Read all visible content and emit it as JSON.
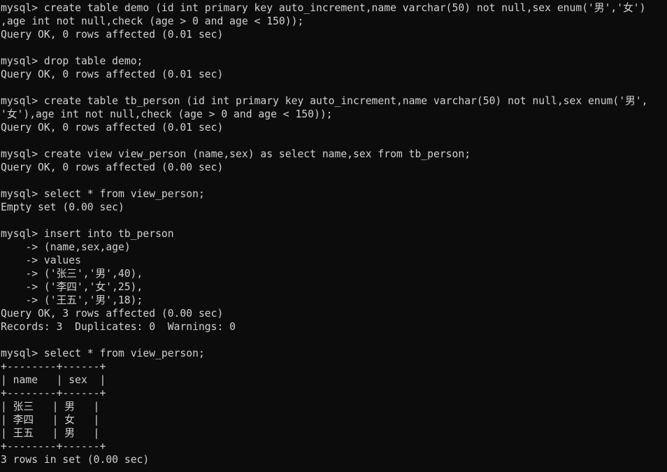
{
  "terminal": {
    "prompt": "mysql> ",
    "continuation_prompt": "    -> ",
    "background_color": "#0c0c0c",
    "text_color": "#d2d2d2",
    "columns": 106,
    "rows": 35,
    "lines": [
      "mysql> create table demo (id int primary key auto_increment,name varchar(50) not null,sex enum('男','女')",
      ",age int not null,check (age > 0 and age < 150));",
      "Query OK, 0 rows affected (0.01 sec)",
      "",
      "mysql> drop table demo;",
      "Query OK, 0 rows affected (0.01 sec)",
      "",
      "mysql> create table tb_person (id int primary key auto_increment,name varchar(50) not null,sex enum('男',",
      "'女'),age int not null,check (age > 0 and age < 150));",
      "Query OK, 0 rows affected (0.01 sec)",
      "",
      "mysql> create view view_person (name,sex) as select name,sex from tb_person;",
      "Query OK, 0 rows affected (0.00 sec)",
      "",
      "mysql> select * from view_person;",
      "Empty set (0.00 sec)",
      "",
      "mysql> insert into tb_person",
      "    -> (name,sex,age)",
      "    -> values",
      "    -> ('张三','男',40),",
      "    -> ('李四','女',25),",
      "    -> ('王五','男',18);",
      "Query OK, 3 rows affected (0.00 sec)",
      "Records: 3  Duplicates: 0  Warnings: 0",
      "",
      "mysql> select * from view_person;",
      "+--------+------+",
      "| name   | sex  |",
      "+--------+------+",
      "| 张三   | 男   |",
      "| 李四   | 女   |",
      "| 王五   | 男   |",
      "+--------+------+",
      "3 rows in set (0.00 sec)"
    ],
    "statements": [
      {
        "sql": "create table demo (id int primary key auto_increment,name varchar(50) not null,sex enum('男','女'),age int not null,check (age > 0 and age < 150));",
        "result": "Query OK, 0 rows affected (0.01 sec)"
      },
      {
        "sql": "drop table demo;",
        "result": "Query OK, 0 rows affected (0.01 sec)"
      },
      {
        "sql": "create table tb_person (id int primary key auto_increment,name varchar(50) not null,sex enum('男','女'),age int not null,check (age > 0 and age < 150));",
        "result": "Query OK, 0 rows affected (0.01 sec)"
      },
      {
        "sql": "create view view_person (name,sex) as select name,sex from tb_person;",
        "result": "Query OK, 0 rows affected (0.00 sec)"
      },
      {
        "sql": "select * from view_person;",
        "result": "Empty set (0.00 sec)"
      },
      {
        "sql": "insert into tb_person (name,sex,age) values ('张三','男',40),('李四','女',25),('王五','男',18);",
        "result": "Query OK, 3 rows affected (0.00 sec)",
        "result_extra": "Records: 3  Duplicates: 0  Warnings: 0"
      },
      {
        "sql": "select * from view_person;",
        "result": "3 rows in set (0.00 sec)"
      }
    ],
    "result_table": {
      "columns": [
        "name",
        "sex"
      ],
      "rows": [
        [
          "张三",
          "男"
        ],
        [
          "李四",
          "女"
        ],
        [
          "王五",
          "男"
        ]
      ],
      "row_count_label": "3 rows in set (0.00 sec)"
    }
  }
}
